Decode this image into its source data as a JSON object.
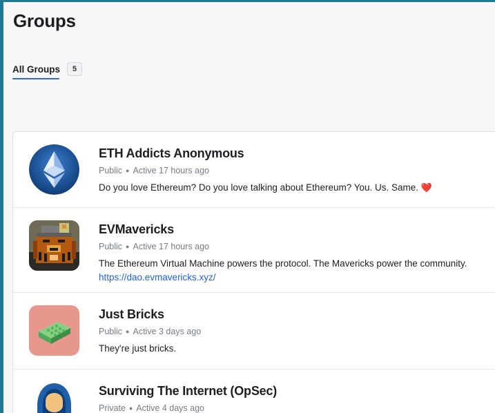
{
  "page": {
    "title": "Groups"
  },
  "tabs": [
    {
      "label": "All Groups",
      "count": "5",
      "active": true
    }
  ],
  "colors": {
    "accent": "#3466d3",
    "link": "#1f62d6",
    "frame": "#1e7a93"
  },
  "groups": [
    {
      "name": "ETH Addicts Anonymous",
      "privacy": "Public",
      "activity": "Active 17 hours ago",
      "description": "Do you love Ethereum? Do you love talking about Ethereum? You. Us. Same.",
      "emoji": "❤️",
      "avatar": "ethereum-logo"
    },
    {
      "name": "EVMavericks",
      "privacy": "Public",
      "activity": "Active 17 hours ago",
      "description": "The Ethereum Virtual Machine powers the protocol. The Mavericks power the community.",
      "link": "https://dao.evmavericks.xyz/",
      "avatar": "pixel-lion"
    },
    {
      "name": "Just Bricks",
      "privacy": "Public",
      "activity": "Active 3 days ago",
      "description": "They're just bricks.",
      "avatar": "brick"
    },
    {
      "name": "Surviving The Internet (OpSec)",
      "privacy": "Private",
      "activity": "Active 4 days ago",
      "avatar": "hooded-figure"
    }
  ]
}
